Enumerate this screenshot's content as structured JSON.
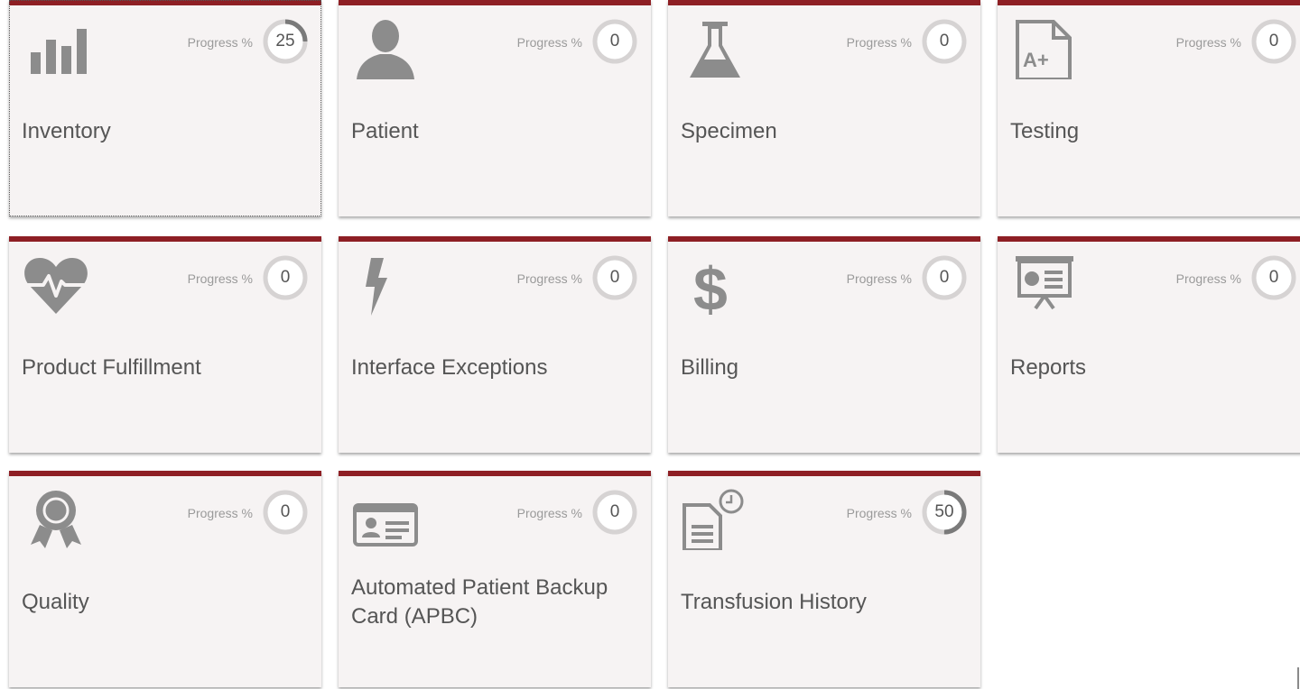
{
  "progress_label": "Progress %",
  "colors": {
    "tile_bg": "#f6f3f3",
    "accent": "#8e1f24",
    "icon": "#8c8c8c",
    "ring_track": "#d6d3d3",
    "ring_fill": "#7a7a7a",
    "text": "#555555"
  },
  "tiles": [
    {
      "title": "Inventory",
      "icon": "bar-chart-icon",
      "progress": 25
    },
    {
      "title": "Patient",
      "icon": "person-icon",
      "progress": 0
    },
    {
      "title": "Specimen",
      "icon": "flask-icon",
      "progress": 0
    },
    {
      "title": "Testing",
      "icon": "grade-document-icon",
      "progress": 0
    },
    {
      "title": "Product Fulfillment",
      "icon": "heart-pulse-icon",
      "progress": 0
    },
    {
      "title": "Interface Exceptions",
      "icon": "lightning-icon",
      "progress": 0
    },
    {
      "title": "Billing",
      "icon": "dollar-icon",
      "progress": 0
    },
    {
      "title": "Reports",
      "icon": "presentation-board-icon",
      "progress": 0
    },
    {
      "title": "Quality",
      "icon": "award-ribbon-icon",
      "progress": 0
    },
    {
      "title": "Automated Patient Backup Card (APBC)",
      "icon": "id-card-icon",
      "progress": 0
    },
    {
      "title": "Transfusion History",
      "icon": "document-clock-icon",
      "progress": 50
    }
  ]
}
